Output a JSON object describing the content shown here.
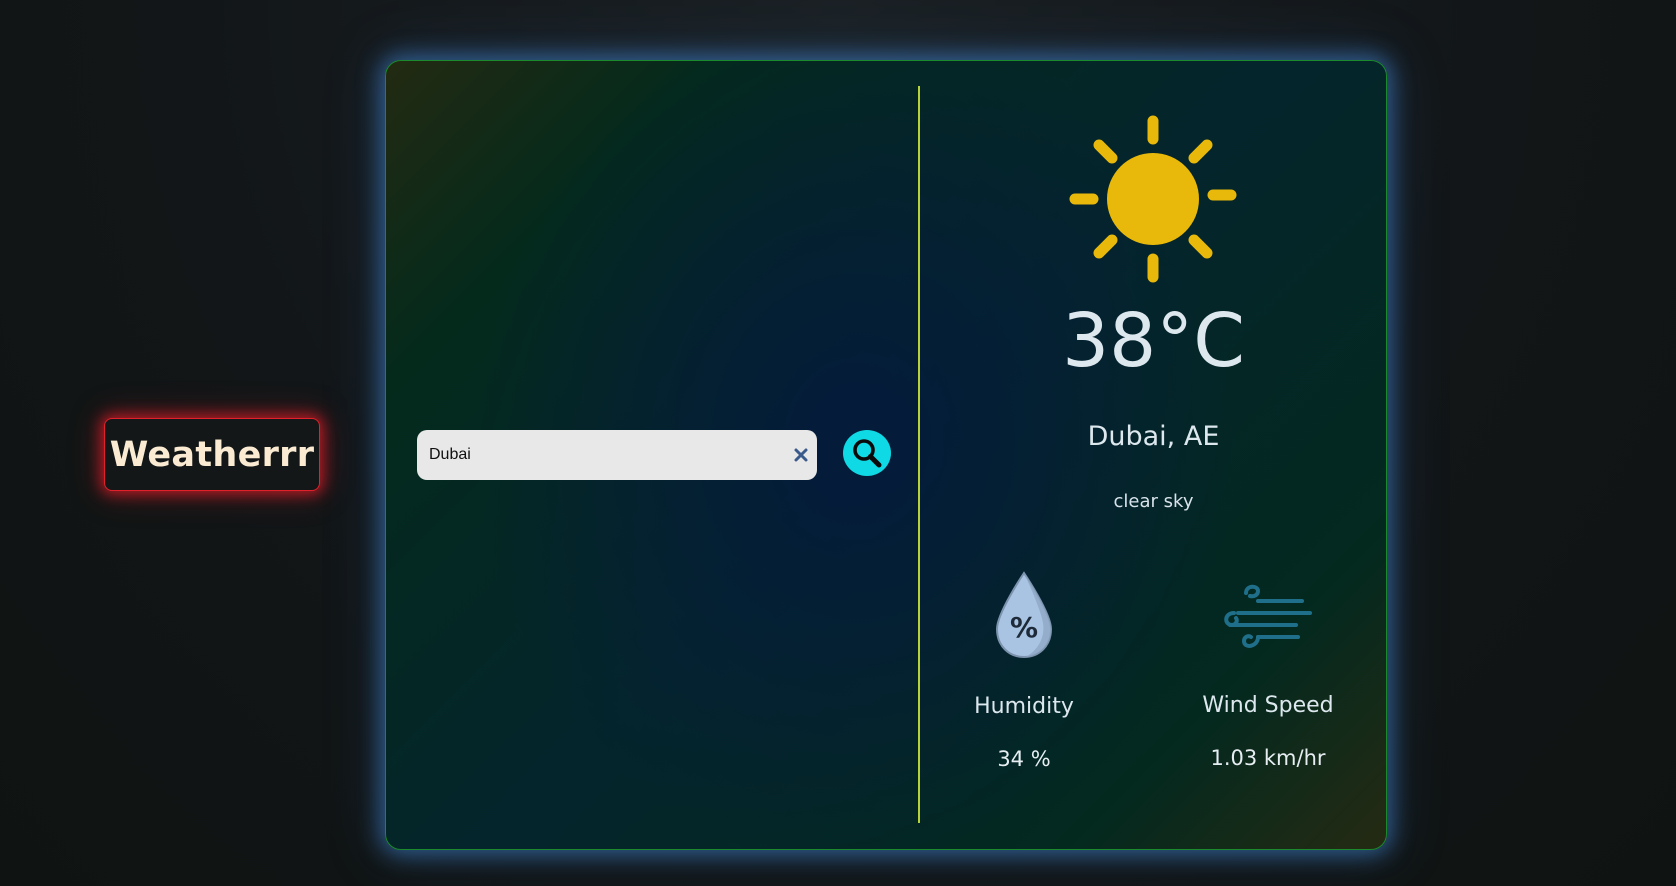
{
  "brand": {
    "title": "Weatherrr"
  },
  "search": {
    "value": "Dubai",
    "clear_icon": "close-icon",
    "button_icon": "search-icon"
  },
  "weather": {
    "icon": "sun-icon",
    "temperature": "38°C",
    "location": "Dubai, AE",
    "description": "clear sky"
  },
  "stats": {
    "humidity": {
      "label": "Humidity",
      "value": "34 %",
      "icon": "humidity-drop-icon"
    },
    "wind": {
      "label": "Wind Speed",
      "value": "1.03 km/hr",
      "icon": "wind-icon"
    }
  },
  "colors": {
    "brand_border": "#e0202a",
    "brand_text": "#fbebd2",
    "card_border": "#1a8a2c",
    "card_glow": "#468cdc",
    "divider": "#b8d33a",
    "search_button": "#0fd9e4",
    "sun": "#e8b90a"
  }
}
